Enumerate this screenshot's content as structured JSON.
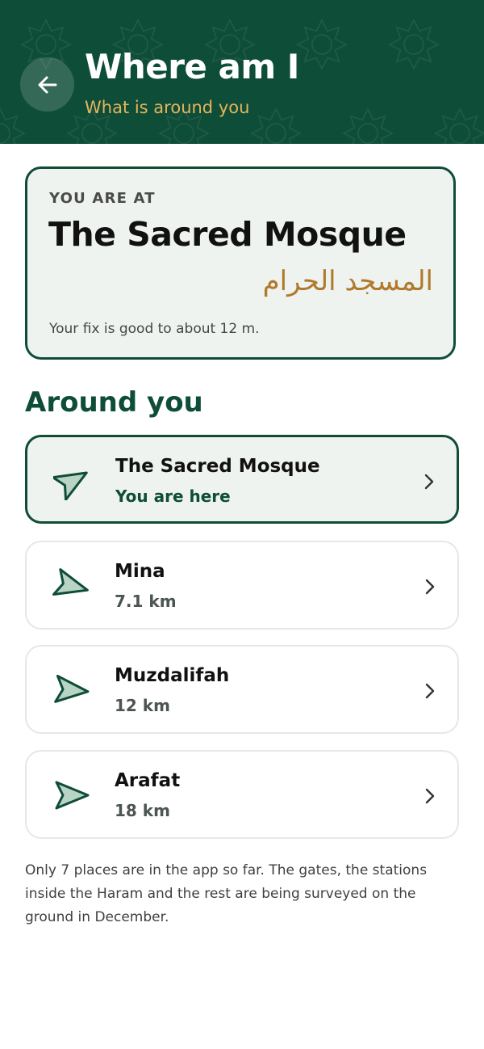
{
  "header": {
    "title": "Where am I",
    "subtitle": "What is around you",
    "back_icon": "arrow-left-icon"
  },
  "current_location": {
    "label": "YOU ARE AT",
    "name": "The Sacred Mosque",
    "arabic_name": "المسجد الحرام",
    "accuracy_text": "Your fix is good to about 12 m."
  },
  "around": {
    "title": "Around you",
    "places": [
      {
        "name": "The Sacred Mosque",
        "detail": "You are here",
        "current": true,
        "heading_deg": -30
      },
      {
        "name": "Mina",
        "detail": "7.1 km",
        "current": false,
        "heading_deg": 15
      },
      {
        "name": "Muzdalifah",
        "detail": "12 km",
        "current": false,
        "heading_deg": 5
      },
      {
        "name": "Arafat",
        "detail": "18 km",
        "current": false,
        "heading_deg": 0
      }
    ]
  },
  "footnote": "Only 7 places are in the app so far. The gates, the stations inside the Haram and the rest are being surveyed on the ground in December.",
  "colors": {
    "primary": "#0e4d38",
    "accent_gold": "#e6b45c",
    "arabic_gold": "#b07a2c",
    "card_bg": "#eff3ef",
    "icon_fill": "#b9d4c4"
  }
}
